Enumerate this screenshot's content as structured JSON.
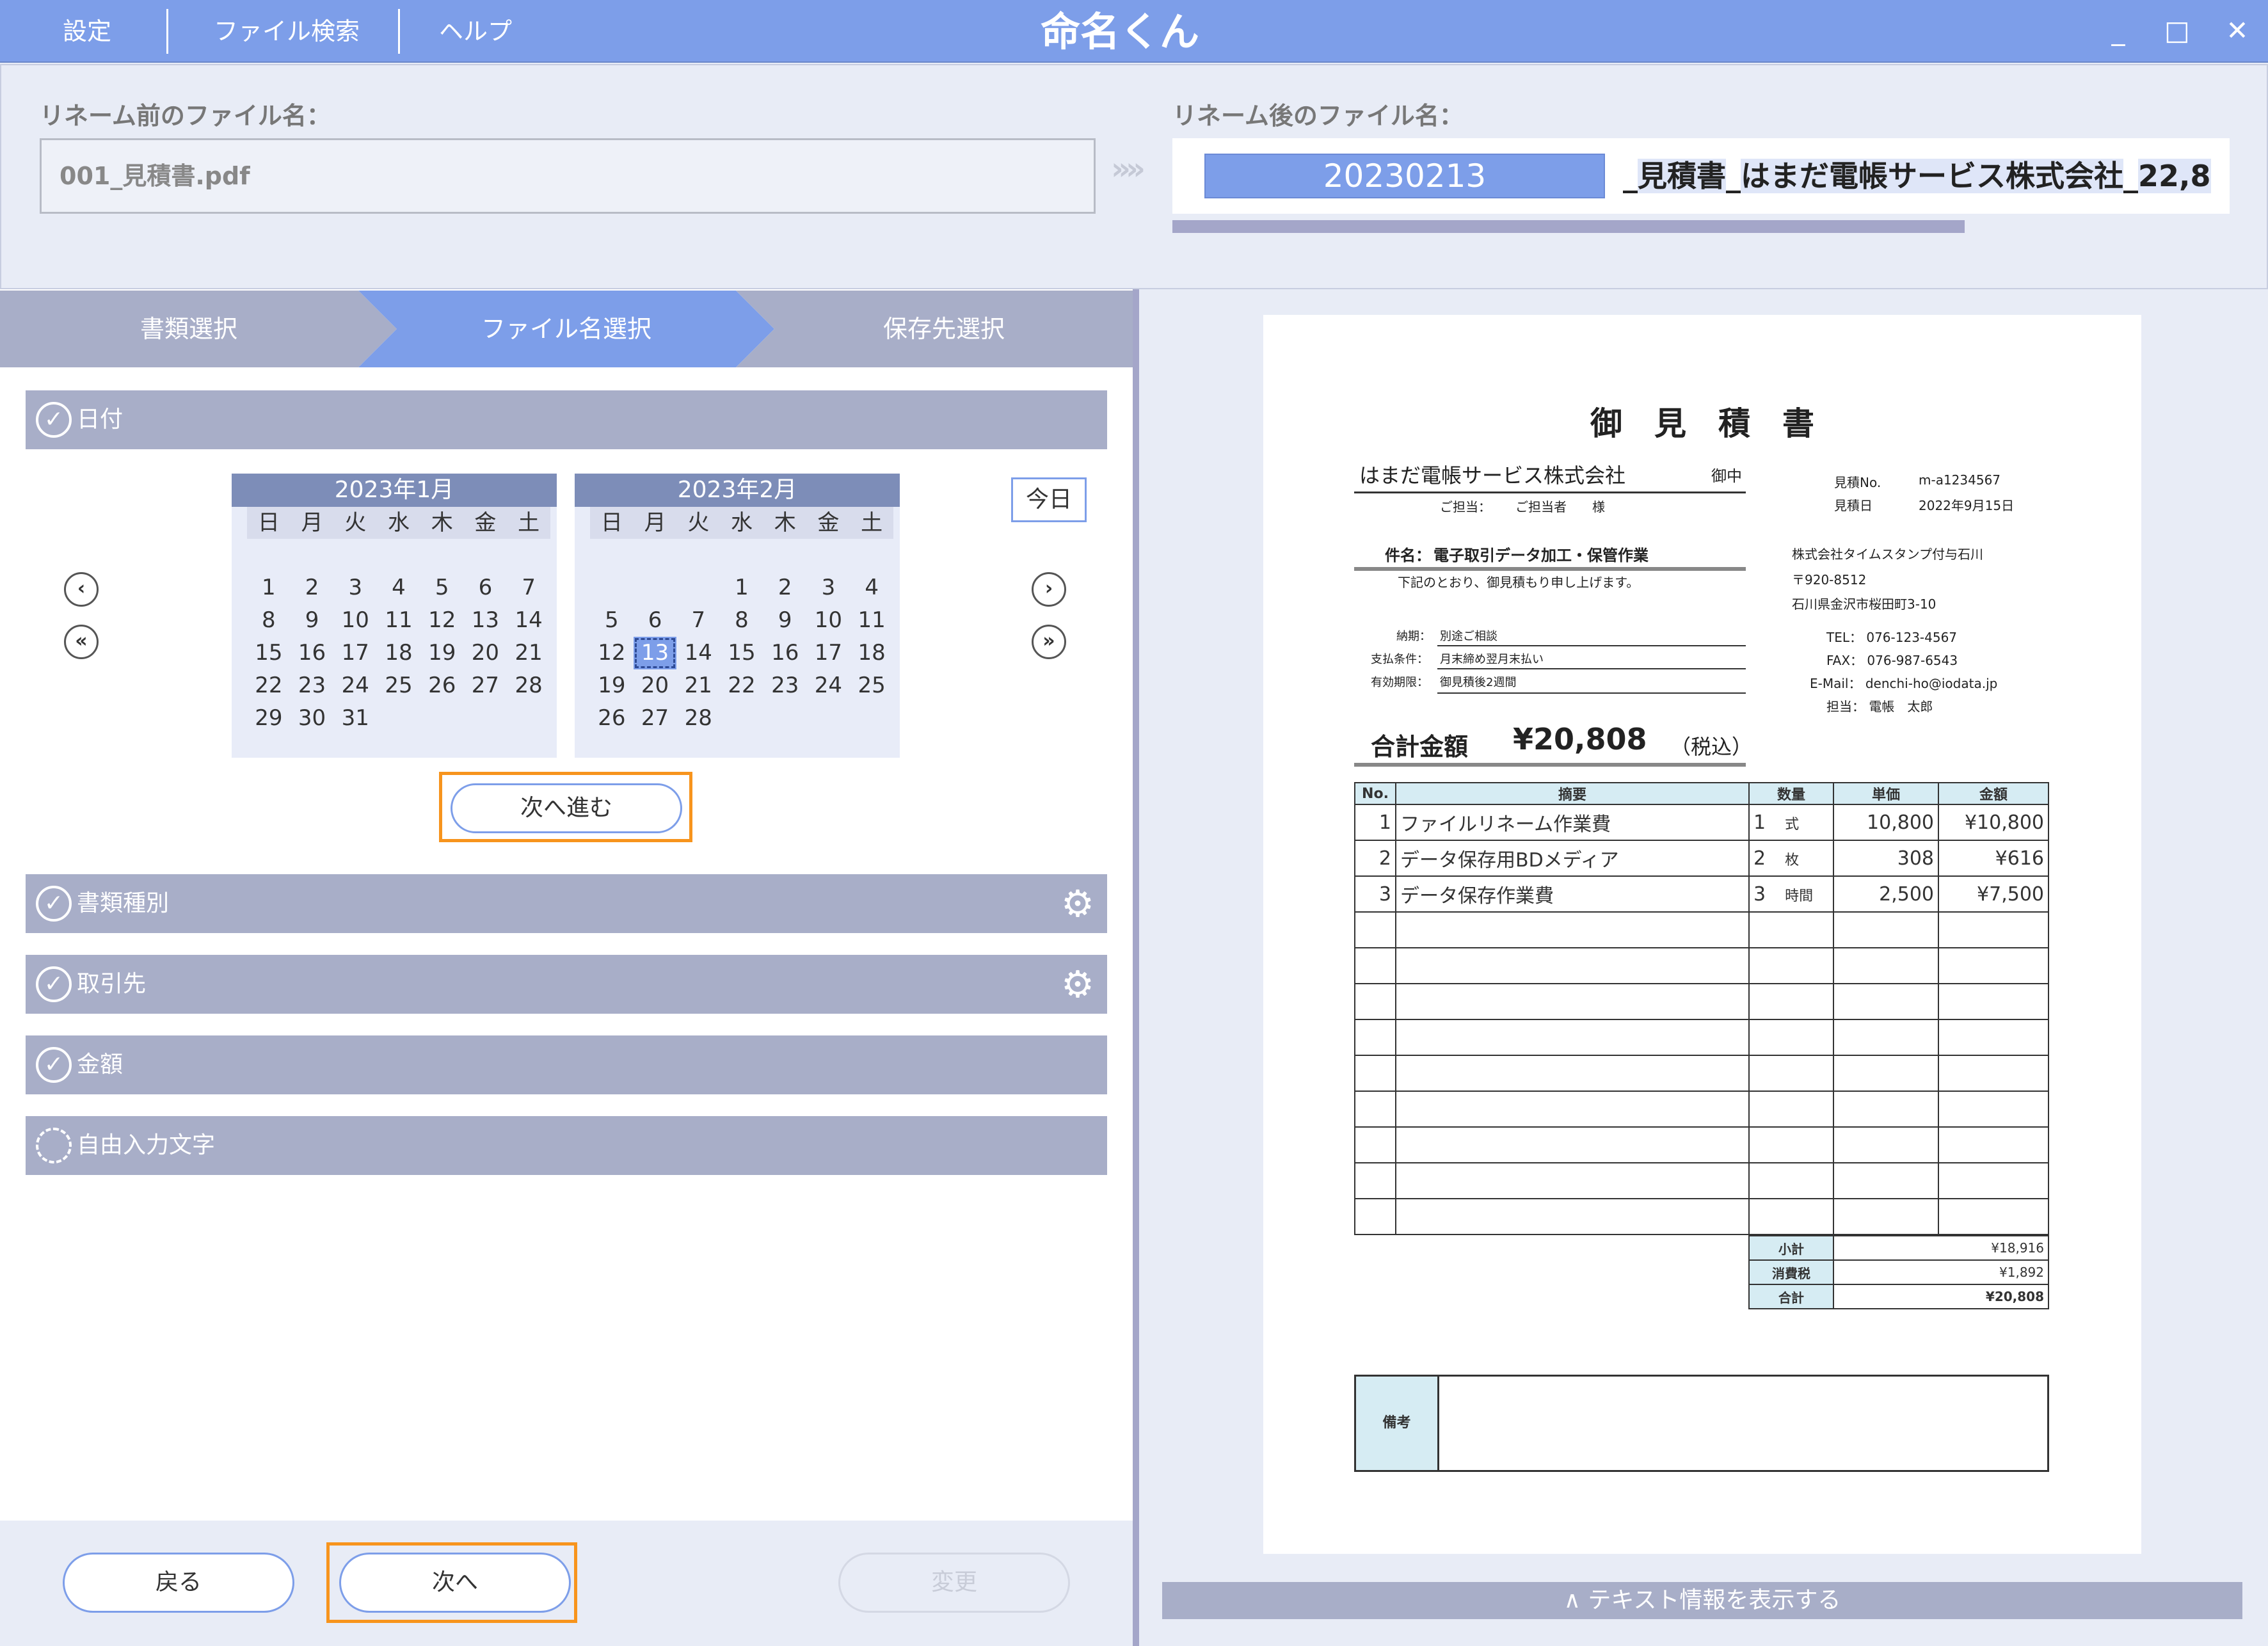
{
  "menu": {
    "settings": "設定",
    "file_search": "ファイル検索",
    "help": "ヘルプ"
  },
  "app": {
    "logo": "命名くん"
  },
  "window": {
    "minimize": "_",
    "maximize": "□",
    "close": "✕"
  },
  "rename": {
    "before_label": "リネーム前のファイル名：",
    "before_value": "001_見積書.pdf",
    "arrows": "»»",
    "after_label": "リネーム後のファイル名：",
    "after_date": "20230213",
    "after_sep1": "_",
    "after_doc_type": "見積書",
    "after_sep2": "_",
    "after_partner": "はまだ電帳サービス株式会社",
    "after_sep3": "_",
    "after_amount": "22,8"
  },
  "steps": [
    "書類選択",
    "ファイル名選択",
    "保存先選択"
  ],
  "sections": {
    "date": "日付",
    "doc_type": "書類種別",
    "partner": "取引先",
    "amount": "金額",
    "free_text": "自由入力文字"
  },
  "calendar": {
    "weekdays": [
      "日",
      "月",
      "火",
      "水",
      "木",
      "金",
      "土"
    ],
    "months": [
      {
        "title": "2023年1月",
        "days": [
          "",
          "",
          "",
          "",
          "",
          "",
          "",
          "1",
          "2",
          "3",
          "4",
          "5",
          "6",
          "7",
          "8",
          "9",
          "10",
          "11",
          "12",
          "13",
          "14",
          "15",
          "16",
          "17",
          "18",
          "19",
          "20",
          "21",
          "22",
          "23",
          "24",
          "25",
          "26",
          "27",
          "28",
          "29",
          "30",
          "31"
        ]
      },
      {
        "title": "2023年2月",
        "days": [
          "",
          "",
          "",
          "",
          "",
          "",
          "",
          "",
          "",
          "",
          "1",
          "2",
          "3",
          "4",
          "5",
          "6",
          "7",
          "8",
          "9",
          "10",
          "11",
          "12",
          "13",
          "14",
          "15",
          "16",
          "17",
          "18",
          "19",
          "20",
          "21",
          "22",
          "23",
          "24",
          "25",
          "26",
          "27",
          "28"
        ]
      }
    ],
    "selected": "2023-02-13",
    "today_label": "今日",
    "prev": "‹",
    "prev_fast": "«",
    "next": "›",
    "next_fast": "»"
  },
  "buttons": {
    "next_step": "次へ進む",
    "back": "戻る",
    "next": "次へ",
    "change": "変更"
  },
  "show_text_bar": "∧ テキスト情報を表示する",
  "document": {
    "title": "御　見　積　書",
    "customer": "はまだ電帳サービス株式会社",
    "honorific": "御中",
    "contact_label": "ご担当：",
    "contact_value": "ご担当者　　様",
    "estimate_no_label": "見積No.",
    "estimate_no": "m-a1234567",
    "estimate_date_label": "見積日",
    "estimate_date": "2022年9月15日",
    "subject_label": "件名：",
    "subject": "電子取引データ加工・保管作業",
    "intro": "下記のとおり、御見積もり申し上げます。",
    "company": "株式会社タイムスタンプ付与石川",
    "postal": "〒920-8512",
    "address": "石川県金沢市桜田町3-10",
    "tel": "TEL：  076-123-4567",
    "fax": "FAX：  076-987-6543",
    "email": "E-Mail：  denchi-ho@iodata.jp",
    "staff": "担当：  電帳　太郎",
    "delivery_label": "納期：",
    "delivery": "別途ご相談",
    "payment_label": "支払条件：",
    "payment": "月末締め翌月末払い",
    "validity_label": "有効期限：",
    "validity": "御見積後2週間",
    "total_label": "合計金額",
    "total_value": "¥20,808",
    "total_note": "（税込）",
    "table_headers": [
      "No.",
      "摘要",
      "数量",
      "単価",
      "金額"
    ],
    "items": [
      {
        "no": "1",
        "desc": "ファイルリネーム作業費",
        "qty": "1",
        "unit": "式",
        "price": "10,800",
        "amount": "¥10,800"
      },
      {
        "no": "2",
        "desc": "データ保存用BDメディア",
        "qty": "2",
        "unit": "枚",
        "price": "308",
        "amount": "¥616"
      },
      {
        "no": "3",
        "desc": "データ保存作業費",
        "qty": "3",
        "unit": "時間",
        "price": "2,500",
        "amount": "¥7,500"
      }
    ],
    "subtotal_label": "小計",
    "subtotal": "¥18,916",
    "tax_label": "消費税",
    "tax": "¥1,892",
    "grand_label": "合計",
    "grand": "¥20,808",
    "remarks_label": "備考"
  },
  "colors": {
    "accent": "#7d9ee9",
    "section_header": "#a8aec8",
    "highlight": "#f7941d"
  }
}
